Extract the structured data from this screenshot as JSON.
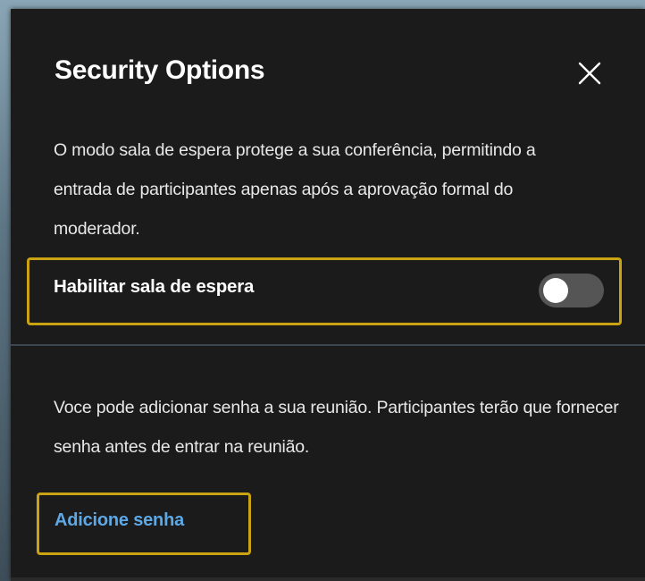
{
  "dialog": {
    "title": "Security Options",
    "close_icon": "close-icon"
  },
  "lobby": {
    "description": "O modo sala de espera protege a sua conferência, permitindo a entrada de participantes apenas após a aprovação formal do moderador.",
    "toggle_label": "Habilitar sala de espera",
    "toggle_enabled": false
  },
  "password": {
    "description": "Voce pode adicionar senha a sua reunião. Participantes terão que fornecer senha antes de entrar na reunião.",
    "add_label": "Adicione senha"
  },
  "colors": {
    "background": "#1b1b1b",
    "text": "#e8e8e8",
    "link": "#5ea8e6",
    "highlight": "#c9a312",
    "toggle_off": "#555555"
  }
}
